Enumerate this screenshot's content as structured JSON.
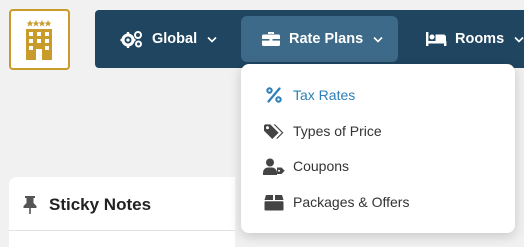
{
  "logo": {
    "icon": "hotel-building-logo",
    "stars": 4,
    "colors": {
      "gold": "#c89b2b",
      "frame": "#c89b2b"
    }
  },
  "nav": {
    "items": [
      {
        "label": "Global",
        "icon": "gears-icon"
      },
      {
        "label": "Rate Plans",
        "icon": "briefcase-icon",
        "active": true
      },
      {
        "label": "Rooms",
        "icon": "bed-icon"
      }
    ],
    "colors": {
      "background": "#1f4561",
      "active": "#3e6a89"
    }
  },
  "dropdown": {
    "items": [
      {
        "label": "Tax Rates",
        "icon": "percent-icon",
        "active": true
      },
      {
        "label": "Types of Price",
        "icon": "tags-icon"
      },
      {
        "label": "Coupons",
        "icon": "user-tag-icon"
      },
      {
        "label": "Packages & Offers",
        "icon": "box-icon"
      }
    ],
    "colors": {
      "active_text": "#2c7fb8"
    }
  },
  "card": {
    "title": "Sticky Notes",
    "icon": "thumbtack-icon"
  }
}
